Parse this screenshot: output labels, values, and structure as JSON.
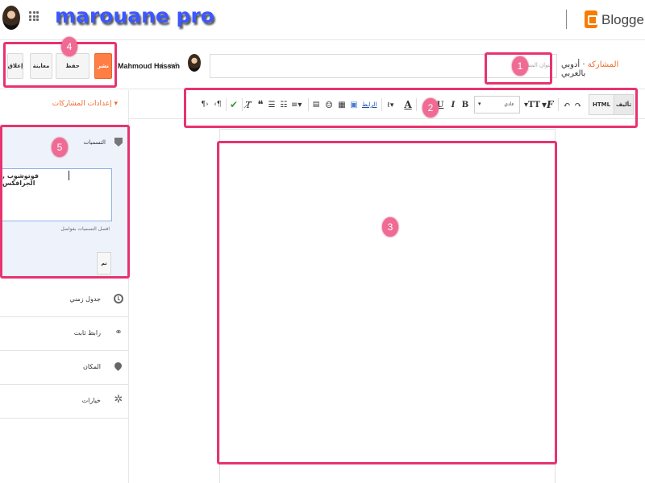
{
  "header": {
    "brand_overlay": "marouane pro",
    "app_name": "Blogger"
  },
  "post_bar": {
    "buttons": {
      "publish": "نشر",
      "save": "حفظ",
      "preview": "معاينة",
      "close": "إغلاق"
    },
    "author_prefix": "النشر باسم",
    "author_name": "Mahmoud Hassan",
    "title_placeholder": "عنوان المشاركة",
    "blog_name": "أدوبي بالعربي",
    "crumb_separator": "·",
    "crumb_current": "المشاركة"
  },
  "toolbar": {
    "compose_label": "تأليف",
    "html_label": "HTML",
    "font_value": "عادي",
    "link_label": "الرابط",
    "bold": "B",
    "italic": "I",
    "underline": "U",
    "text_color": "A",
    "font_size": "T",
    "font_family": "F"
  },
  "sidebar": {
    "settings_title": "إعدادات المشاركات",
    "labels": {
      "title": "التسميات",
      "value": "فوتوشوب , الجرافكس",
      "hint": "افصل التسميات بفواصل",
      "done": "تم"
    },
    "items": [
      {
        "label": "جدول زمني",
        "icon": "clock-icon"
      },
      {
        "label": "رابط ثابت",
        "icon": "link-icon"
      },
      {
        "label": "المكان",
        "icon": "location-pin-icon"
      },
      {
        "label": "خيارات",
        "icon": "gear-icon"
      }
    ]
  },
  "annotations": [
    "1",
    "2",
    "3",
    "4",
    "5"
  ],
  "colors": {
    "accent_orange": "#f06a2b",
    "publish_orange": "#ff7e45",
    "highlight_pink": "#e8336f",
    "marker_pink": "#f06b94",
    "brand_blue": "#3b57ff"
  }
}
